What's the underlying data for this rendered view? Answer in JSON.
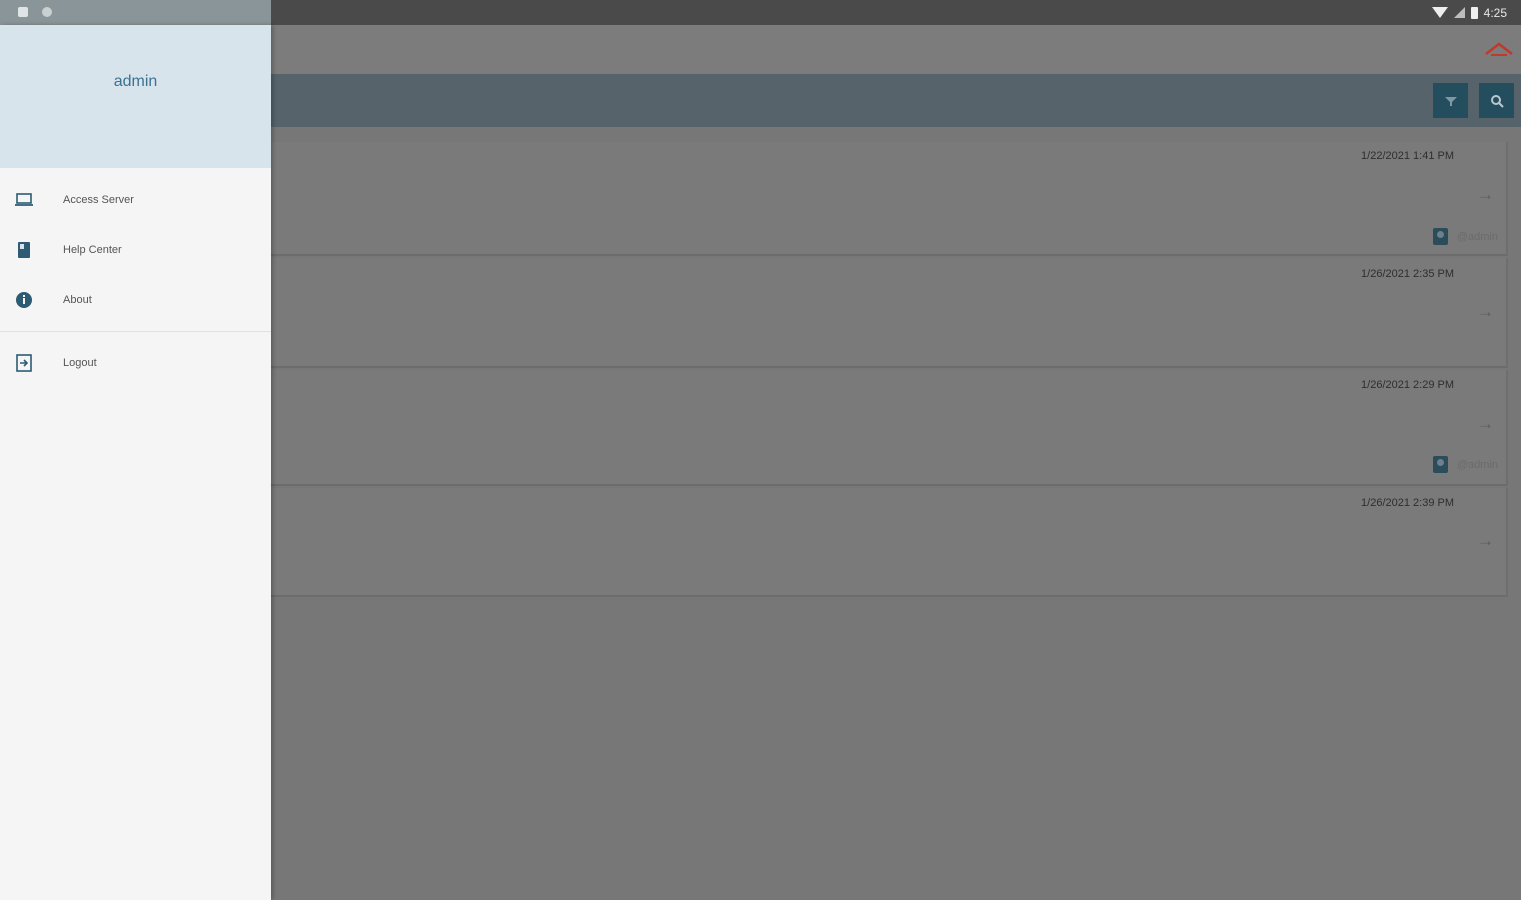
{
  "status_bar": {
    "time": "4:25"
  },
  "drawer": {
    "username": "admin",
    "items": [
      {
        "label": "Access Server",
        "icon": "laptop-icon"
      },
      {
        "label": "Help Center",
        "icon": "book-icon"
      },
      {
        "label": "About",
        "icon": "info-icon"
      }
    ],
    "logout": {
      "label": "Logout",
      "icon": "logout-icon"
    }
  },
  "toolbar": {
    "filter_icon": "filter-icon",
    "search_icon": "search-icon"
  },
  "cards": [
    {
      "date": "1/22/2021 1:41 PM",
      "user": "@admin"
    },
    {
      "date": "1/26/2021 2:35 PM",
      "user": ""
    },
    {
      "date": "1/26/2021 2:29 PM",
      "user": "@admin"
    },
    {
      "date": "1/26/2021 2:39 PM",
      "user": ""
    }
  ],
  "colors": {
    "accent": "#3c7192",
    "toolbar": "#56636a",
    "button": "#244d5e",
    "drawer_header": "#d7e4ec",
    "home_icon": "#c0392b"
  }
}
